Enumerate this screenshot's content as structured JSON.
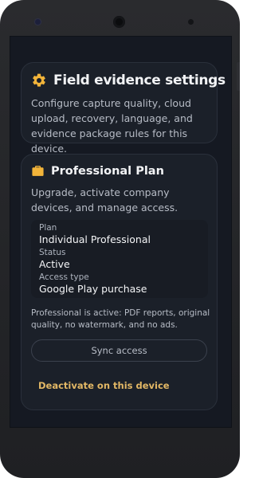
{
  "settings_card": {
    "icon": "gear-icon",
    "title": "Field evidence settings",
    "description": "Configure capture quality, cloud upload, recovery, language, and evidence package rules for this device."
  },
  "plan_card": {
    "icon": "briefcase-icon",
    "title": "Professional Plan",
    "description": "Upgrade, activate company devices, and manage access.",
    "plan_label": "Plan",
    "plan_value": "Individual Professional",
    "status_label": "Status",
    "status_value": "Active",
    "access_label": "Access type",
    "access_value": "Google Play purchase",
    "note": "Professional is active: PDF reports, original quality, no watermark, and no ads.",
    "sync_button": "Sync access",
    "deactivate_link": "Deactivate on this device"
  },
  "colors": {
    "accent": "#e2b765",
    "card_bg": "#1b2029",
    "screen_bg": "#151922"
  }
}
